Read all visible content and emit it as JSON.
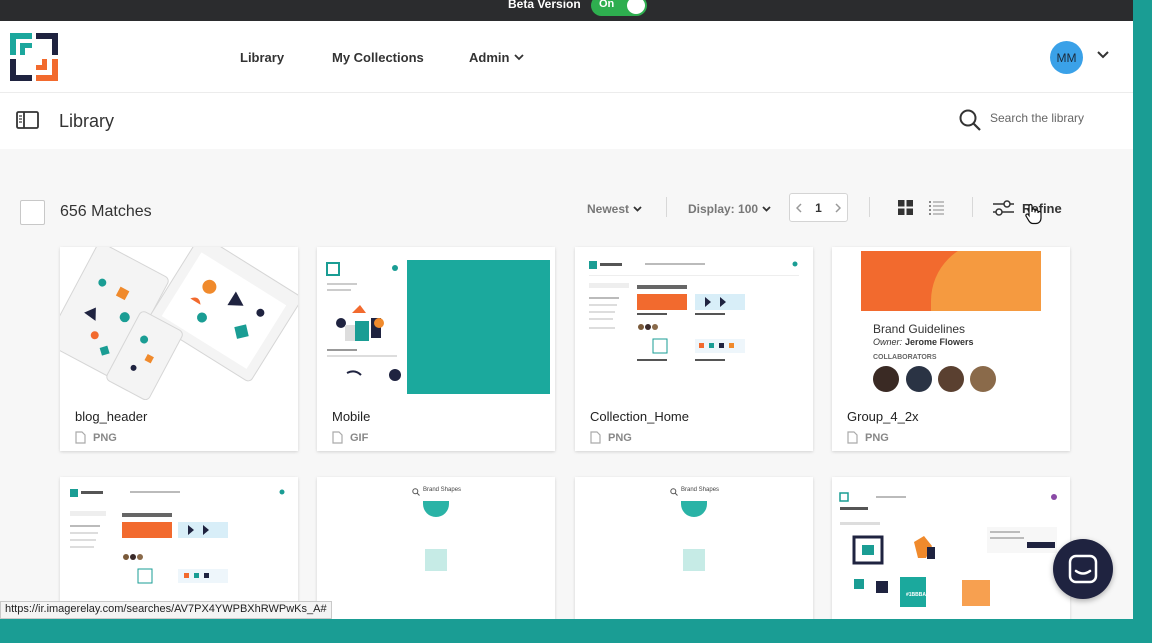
{
  "beta": {
    "label": "Beta Version",
    "toggle_text": "On",
    "toggle_color": "#2eae4f"
  },
  "nav": {
    "library": "Library",
    "my_collections": "My Collections",
    "admin": "Admin",
    "avatar_initials": "MM"
  },
  "library_bar": {
    "title": "Library",
    "search_placeholder": "Search the library"
  },
  "toolbar": {
    "matches": "656 Matches",
    "sort": "Newest",
    "display": "Display: 100",
    "page": "1",
    "refine": "Refine"
  },
  "cards": [
    {
      "name": "blog_header",
      "type": "PNG"
    },
    {
      "name": "Mobile",
      "type": "GIF"
    },
    {
      "name": "Collection_Home",
      "type": "PNG"
    },
    {
      "name": "Group_4_2x",
      "type": "PNG"
    }
  ],
  "group4_thumb": {
    "title": "Brand Guidelines",
    "owner_label": "Owner:",
    "owner_name": "Jerome Flowers",
    "collaborators": "COLLABORATORS"
  },
  "row2_thumbs": {
    "brand_shapes_1": "Brand Shapes",
    "brand_shapes_2": "Brand Shapes",
    "hex_color": "#1BBBAC"
  },
  "status_url": "https://ir.imagerelay.com/searches/AV7PX4YWPBXhRWPwKs_A#",
  "colors": {
    "teal": "#1a9d94",
    "orange": "#f26a2e",
    "navy": "#1f2340",
    "avatar": "#3aa1e8"
  }
}
